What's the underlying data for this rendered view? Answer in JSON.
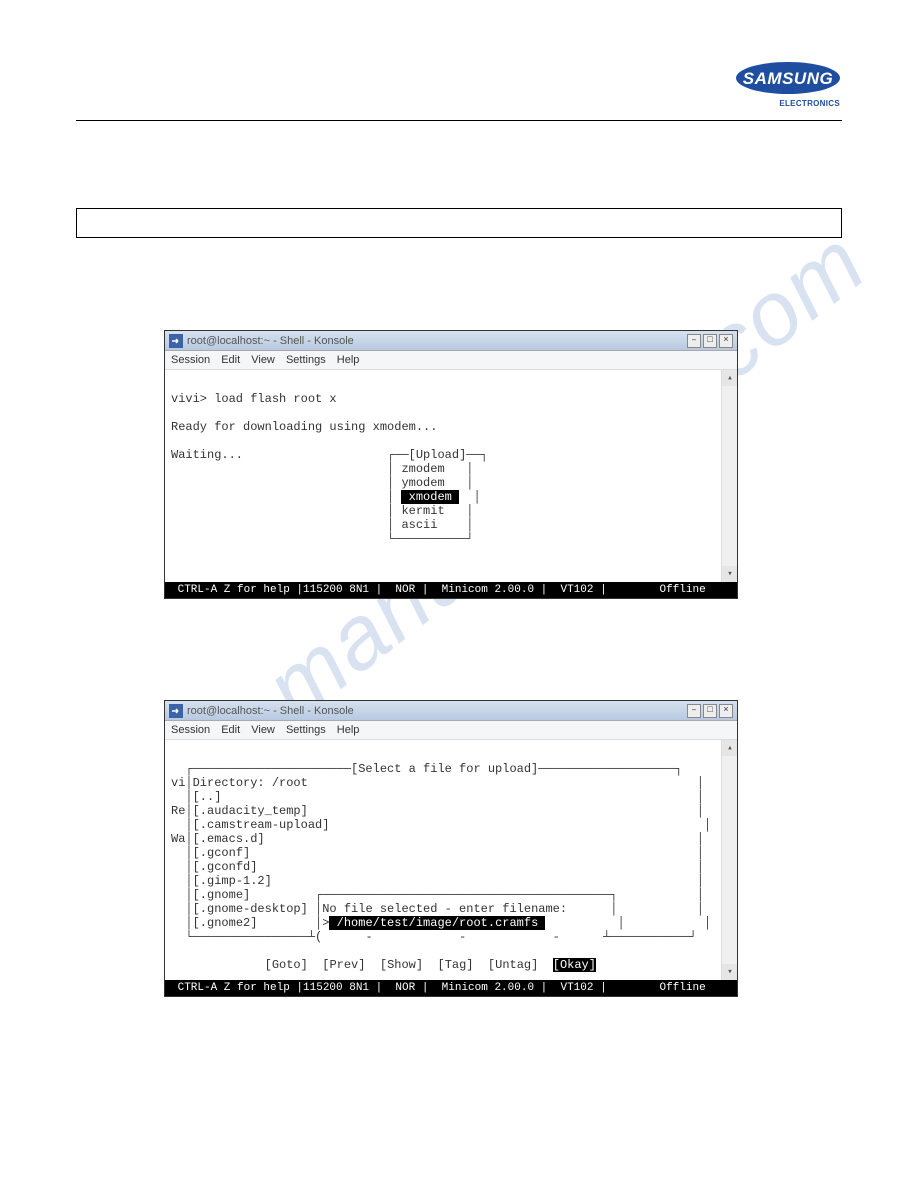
{
  "brand": {
    "name": "SAMSUNG",
    "sub": "ELECTRONICS"
  },
  "watermark": "manualshive.com",
  "konsole1": {
    "title": "root@localhost:~ - Shell - Konsole",
    "menus": {
      "m1": "Session",
      "m2": "Edit",
      "m3": "View",
      "m4": "Settings",
      "m5": "Help"
    },
    "line_prompt": "vivi> load flash root x",
    "line_ready": "Ready for downloading using xmodem...",
    "line_wait": "Waiting...",
    "upload_title": "[Upload]",
    "upload_opts": {
      "o1": "zmodem",
      "o2": "ymodem",
      "o3_sel": "xmodem",
      "o4": "kermit",
      "o5": "ascii"
    },
    "status": " CTRL-A Z for help |115200 8N1 |  NOR |  Minicom 2.00.0 |  VT102 |        Offline"
  },
  "konsole2": {
    "title": "root@localhost:~ - Shell - Konsole",
    "menus": {
      "m1": "Session",
      "m2": "Edit",
      "m3": "View",
      "m4": "Settings",
      "m5": "Help"
    },
    "select_title": "[Select a file for upload]",
    "left_prefixes": {
      "p1": "vi",
      "p2": "Re",
      "p3": "Wa"
    },
    "dir_label": "Directory: /root",
    "entries": {
      "e1": "[..]",
      "e2": "[.audacity_temp]",
      "e3": "[.camstream-upload]",
      "e4": "[.emacs.d]",
      "e5": "[.gconf]",
      "e6": "[.gconfd]",
      "e7": "[.gimp-1.2]",
      "e8": "[.gnome]",
      "e9": "[.gnome-desktop]",
      "e10": "[.gnome2]"
    },
    "right_box": {
      "prompt": "No file selected - enter filename:",
      "path_sel": "/home/test/image/root.cramfs",
      "caret": ">"
    },
    "bottom_line_paren": "(",
    "buttons": {
      "b1": "[Goto]",
      "b2": "[Prev]",
      "b3": "[Show]",
      "b4": "[Tag]",
      "b5": "[Untag]",
      "b6_sel": "[Okay]"
    },
    "status": " CTRL-A Z for help |115200 8N1 |  NOR |  Minicom 2.00.0 |  VT102 |        Offline"
  },
  "window_controls": {
    "min": "–",
    "max": "□",
    "close": "×"
  }
}
